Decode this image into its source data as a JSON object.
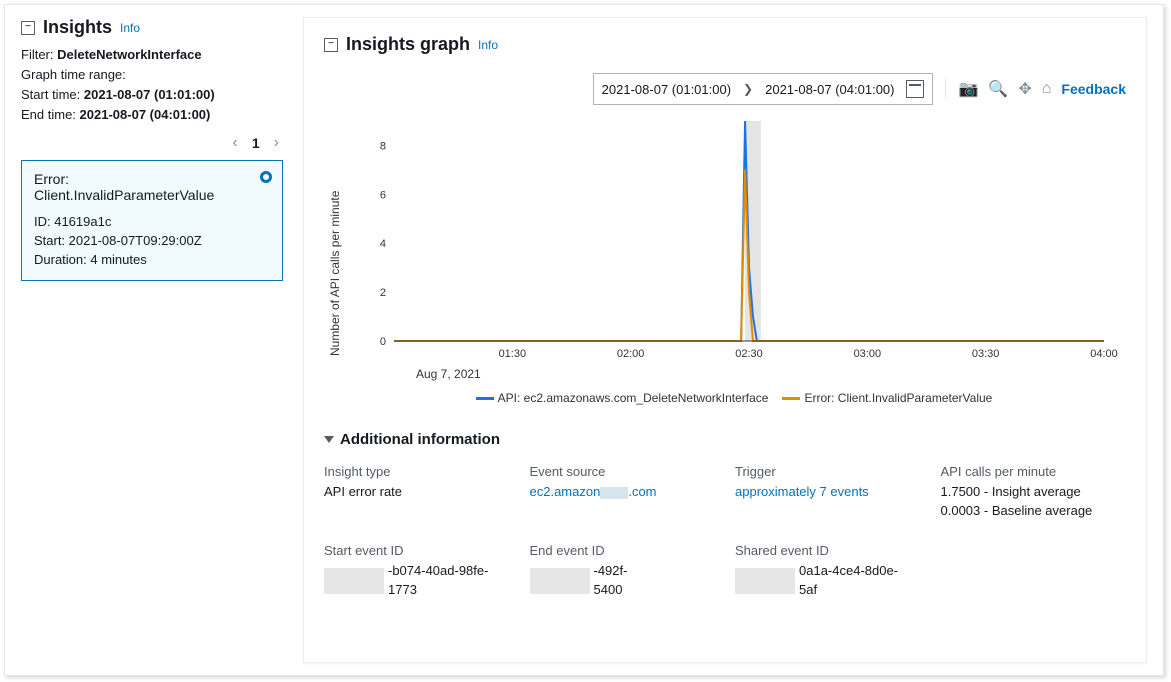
{
  "sidebar": {
    "title": "Insights",
    "info": "Info",
    "filter_label": "Filter:",
    "filter_value": "DeleteNetworkInterface",
    "range_label": "Graph time range:",
    "start_label": "Start time:",
    "start_value": "2021-08-07 (01:01:00)",
    "end_label": "End time:",
    "end_value": "2021-08-07 (04:01:00)",
    "page": "1",
    "card": {
      "error_label": "Error:",
      "error_value": "Client.InvalidParameterValue",
      "id_line": "ID: 41619a1c",
      "start_line": "Start: 2021-08-07T09:29:00Z",
      "duration_line": "Duration: 4 minutes"
    }
  },
  "main": {
    "title": "Insights graph",
    "info": "Info",
    "range_start": "2021-08-07 (01:01:00)",
    "range_end": "2021-08-07 (04:01:00)",
    "feedback": "Feedback",
    "legend": {
      "s1": "API: ec2.amazonaws.com_DeleteNetworkInterface",
      "s2": "Error: Client.InvalidParameterValue"
    },
    "x_date": "Aug 7, 2021",
    "y_title": "Number of API calls per minute"
  },
  "chart_data": {
    "type": "line",
    "x_ticks": [
      "01:30",
      "02:00",
      "02:30",
      "03:00",
      "03:30",
      "04:00"
    ],
    "y_ticks": [
      0,
      2,
      4,
      6,
      8
    ],
    "ylim": [
      0,
      9
    ],
    "xlabel": "Aug 7, 2021",
    "ylabel": "Number of API calls per minute",
    "x_highlight": [
      "02:29",
      "02:33"
    ],
    "x_values_minutes": [
      60,
      90,
      120,
      148,
      149,
      150,
      151,
      152,
      153,
      180,
      210,
      240
    ],
    "series": [
      {
        "name": "API: ec2.amazonaws.com_DeleteNetworkInterface",
        "color": "#1b73e8",
        "values": [
          0,
          0,
          0,
          0,
          9,
          3,
          1,
          0,
          0,
          0,
          0,
          0
        ]
      },
      {
        "name": "Error: Client.InvalidParameterValue",
        "color": "#e58b00",
        "values": [
          0,
          0,
          0,
          0,
          7,
          2,
          0,
          0,
          0,
          0,
          0,
          0
        ]
      }
    ]
  },
  "additional": {
    "heading": "Additional information",
    "rows": {
      "insight_type": {
        "k": "Insight type",
        "v": "API error rate"
      },
      "event_source": {
        "k": "Event source",
        "v_before": "ec2.amazon",
        "v_after": ".com"
      },
      "trigger": {
        "k": "Trigger",
        "v": "approximately 7 events"
      },
      "api_calls": {
        "k": "API calls per minute",
        "v1": "1.7500 - Insight average",
        "v2": "0.0003 - Baseline average"
      },
      "start_id": {
        "k": "Start event ID",
        "tail": "-b074-40ad-98fe-",
        "tail2": "1773"
      },
      "end_id": {
        "k": "End event ID",
        "tail": "-492f-",
        "tail2": "5400"
      },
      "shared_id": {
        "k": "Shared event ID",
        "tail": "0a1a-4ce4-8d0e-",
        "tail2": "5af"
      }
    }
  }
}
